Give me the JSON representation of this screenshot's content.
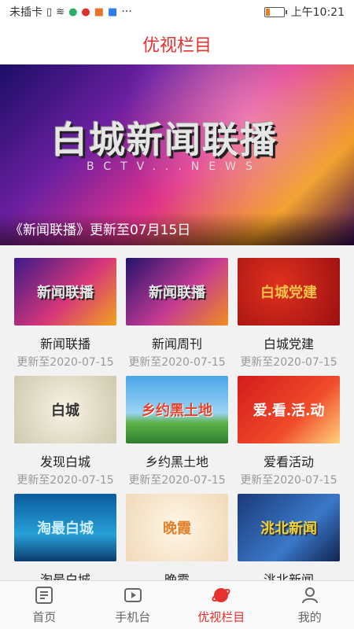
{
  "status_bar": {
    "carrier": "未插卡",
    "time": "上午10:21",
    "more": "···"
  },
  "header": {
    "title": "优视栏目"
  },
  "banner": {
    "logo_text": "白城新闻联播",
    "sub_text": "BCTV...NEWS",
    "caption": "《新闻联播》更新至07月15日"
  },
  "programs": [
    {
      "title": "新闻联播",
      "date": "更新至2020-07-15",
      "thumb_text": "新闻联播"
    },
    {
      "title": "新闻周刊",
      "date": "更新至2020-07-15",
      "thumb_text": "新闻联播"
    },
    {
      "title": "白城党建",
      "date": "更新至2020-07-15",
      "thumb_text": "白城党建"
    },
    {
      "title": "发现白城",
      "date": "更新至2020-07-15",
      "thumb_text": "白城"
    },
    {
      "title": "乡约黑土地",
      "date": "更新至2020-07-15",
      "thumb_text": "乡约黑土地"
    },
    {
      "title": "爱看活动",
      "date": "更新至2020-07-15",
      "thumb_text": "爱.看.活.动"
    },
    {
      "title": "淘最白城",
      "date": "",
      "thumb_text": "淘最白城"
    },
    {
      "title": "晚霞",
      "date": "",
      "thumb_text": "晚霞"
    },
    {
      "title": "洮北新闻",
      "date": "",
      "thumb_text": "洮北新闻"
    }
  ],
  "tabs": [
    {
      "label": "首页",
      "icon": "home-icon",
      "active": false
    },
    {
      "label": "手机台",
      "icon": "video-icon",
      "active": false
    },
    {
      "label": "优视栏目",
      "icon": "planet-icon",
      "active": true
    },
    {
      "label": "我的",
      "icon": "user-icon",
      "active": false
    }
  ],
  "colors": {
    "accent": "#e8302e",
    "date": "#999999"
  }
}
